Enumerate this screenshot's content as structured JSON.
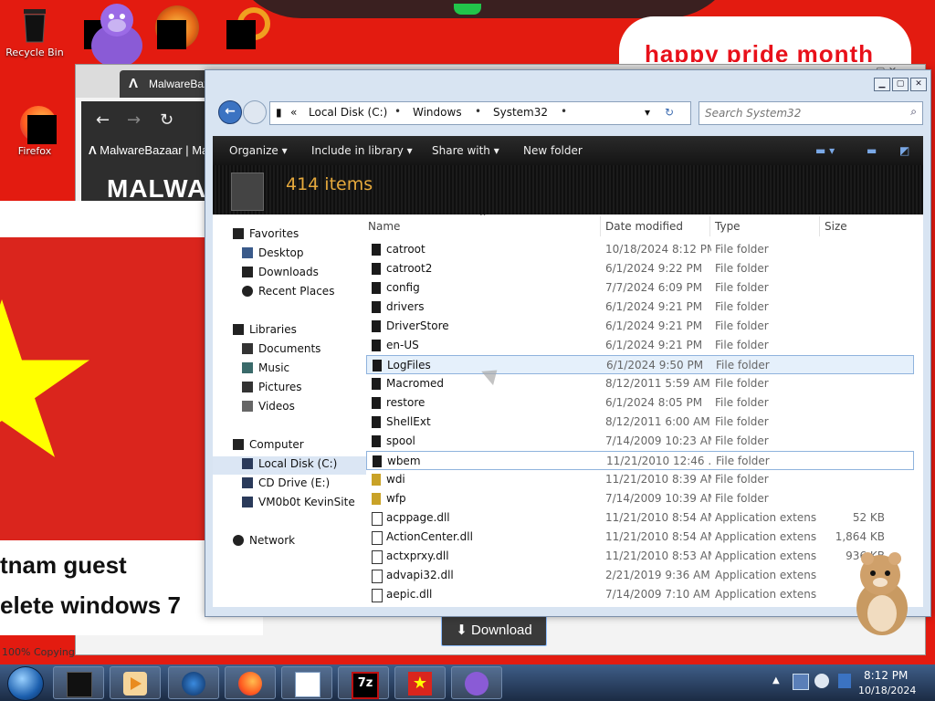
{
  "desktop": {
    "banner_text": "happy pride month",
    "icons": [
      {
        "label": "Recycle Bin",
        "icon": "recycle-bin-icon"
      },
      {
        "label": "Firefox",
        "icon": "firefox-icon"
      }
    ],
    "left_page": {
      "line1": "tnam guest",
      "line2": "elete windows 7",
      "status": "100% Copying"
    },
    "download_label": "Download"
  },
  "browser": {
    "tab_title": "MalwareBazaar",
    "tab_title2": "MalwareBazaar | Ma",
    "heading": "MALWA"
  },
  "explorer": {
    "path": [
      "Local Disk (C:)",
      "Windows",
      "System32"
    ],
    "path_prefix": "«",
    "search_placeholder": "Search System32",
    "commands": [
      "Organize",
      "Include in library",
      "Share with",
      "New folder"
    ],
    "item_count": "414 items",
    "nav": {
      "favorites": "Favorites",
      "favorites_items": [
        "Desktop",
        "Downloads",
        "Recent Places"
      ],
      "libraries": "Libraries",
      "libraries_items": [
        "Documents",
        "Music",
        "Pictures",
        "Videos"
      ],
      "computer": "Computer",
      "computer_items": [
        "Local Disk (C:)",
        "CD Drive (E:)",
        "VM0b0t KevinSite"
      ],
      "network": "Network"
    },
    "columns": {
      "name": "Name",
      "date": "Date modified",
      "type": "Type",
      "size": "Size"
    },
    "rows": [
      {
        "name": "catroot",
        "date": "10/18/2024 8:12 PM",
        "type": "File folder",
        "size": "",
        "kind": "folder"
      },
      {
        "name": "catroot2",
        "date": "6/1/2024 9:22 PM",
        "type": "File folder",
        "size": "",
        "kind": "folder"
      },
      {
        "name": "config",
        "date": "7/7/2024 6:09 PM",
        "type": "File folder",
        "size": "",
        "kind": "folder"
      },
      {
        "name": "drivers",
        "date": "6/1/2024 9:21 PM",
        "type": "File folder",
        "size": "",
        "kind": "folder"
      },
      {
        "name": "DriverStore",
        "date": "6/1/2024 9:21 PM",
        "type": "File folder",
        "size": "",
        "kind": "folder"
      },
      {
        "name": "en-US",
        "date": "6/1/2024 9:21 PM",
        "type": "File folder",
        "size": "",
        "kind": "folder"
      },
      {
        "name": "LogFiles",
        "date": "6/1/2024 9:50 PM",
        "type": "File folder",
        "size": "",
        "kind": "folder"
      },
      {
        "name": "Macromed",
        "date": "8/12/2011 5:59 AM",
        "type": "File folder",
        "size": "",
        "kind": "folder"
      },
      {
        "name": "restore",
        "date": "6/1/2024 8:05 PM",
        "type": "File folder",
        "size": "",
        "kind": "folder"
      },
      {
        "name": "ShellExt",
        "date": "8/12/2011 6:00 AM",
        "type": "File folder",
        "size": "",
        "kind": "folder"
      },
      {
        "name": "spool",
        "date": "7/14/2009 10:23 AM",
        "type": "File folder",
        "size": "",
        "kind": "folder"
      },
      {
        "name": "wbem",
        "date": "11/21/2010 12:46 ...",
        "type": "File folder",
        "size": "",
        "kind": "folder"
      },
      {
        "name": "wdi",
        "date": "11/21/2010 8:39 AM",
        "type": "File folder",
        "size": "",
        "kind": "folder-lock"
      },
      {
        "name": "wfp",
        "date": "7/14/2009 10:39 AM",
        "type": "File folder",
        "size": "",
        "kind": "folder-lock"
      },
      {
        "name": "acppage.dll",
        "date": "11/21/2010 8:54 AM",
        "type": "Application extens...",
        "size": "52 KB",
        "kind": "dll"
      },
      {
        "name": "ActionCenter.dll",
        "date": "11/21/2010 8:54 AM",
        "type": "Application extens...",
        "size": "1,864 KB",
        "kind": "dll"
      },
      {
        "name": "actxprxy.dll",
        "date": "11/21/2010 8:53 AM",
        "type": "Application extens...",
        "size": "936 KB",
        "kind": "dll"
      },
      {
        "name": "advapi32.dll",
        "date": "2/21/2019 9:36 AM",
        "type": "Application extens...",
        "size": "",
        "kind": "dll"
      },
      {
        "name": "aepic.dll",
        "date": "7/14/2009 7:10 AM",
        "type": "Application extens...",
        "size": "",
        "kind": "dll"
      }
    ]
  },
  "taskbar": {
    "time": "8:12 PM",
    "date": "10/18/2024",
    "apps": [
      "explorer-icon",
      "media-player-icon",
      "browser-globe-icon",
      "firefox-icon",
      "notepad-icon",
      "7zip-icon",
      "flag-icon",
      "bonzi-icon"
    ],
    "app_7z_label": "7z"
  },
  "colors": {
    "desktop_red": "#e31b10",
    "item_count": "#e6a93c",
    "selection": "#e5f0fb",
    "taskbar": "#2b4566"
  }
}
